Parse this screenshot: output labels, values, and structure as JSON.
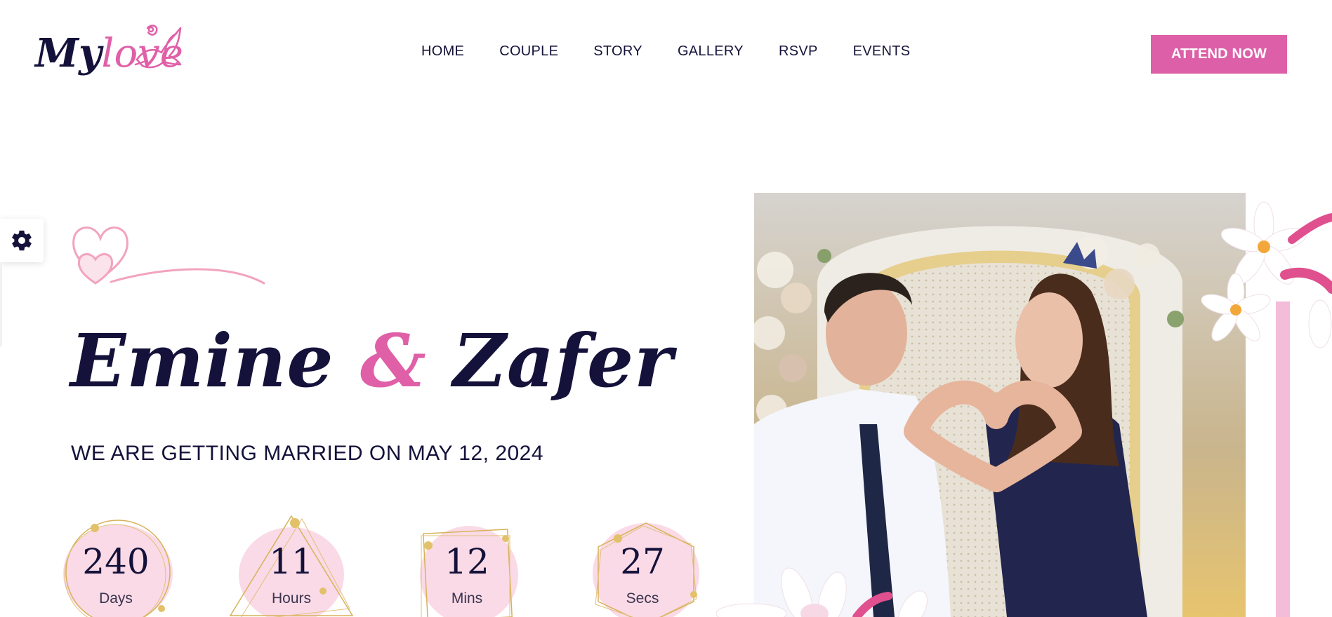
{
  "logo": {
    "text_my": "My",
    "text_love": "love",
    "icon": "dove-icon"
  },
  "nav": {
    "items": [
      {
        "label": "HOME"
      },
      {
        "label": "COUPLE"
      },
      {
        "label": "STORY"
      },
      {
        "label": "GALLERY"
      },
      {
        "label": "RSVP"
      },
      {
        "label": "EVENTS"
      }
    ]
  },
  "header": {
    "cta_label": "ATTEND NOW"
  },
  "settings": {
    "icon": "gear-icon"
  },
  "hero": {
    "bride": "Emine",
    "ampersand": "&",
    "groom": "Zafer",
    "subtitle": "WE ARE GETTING MARRIED ON MAY 12, 2024",
    "photo_icon": "couple-photo"
  },
  "countdown": [
    {
      "value": "240",
      "label": "Days"
    },
    {
      "value": "11",
      "label": "Hours"
    },
    {
      "value": "12",
      "label": "Mins"
    },
    {
      "value": "27",
      "label": "Secs"
    }
  ],
  "colors": {
    "accent": "#dd5fa8",
    "navy": "#14123a",
    "soft_pink": "#f6c8da",
    "gold": "#d8b25a"
  }
}
